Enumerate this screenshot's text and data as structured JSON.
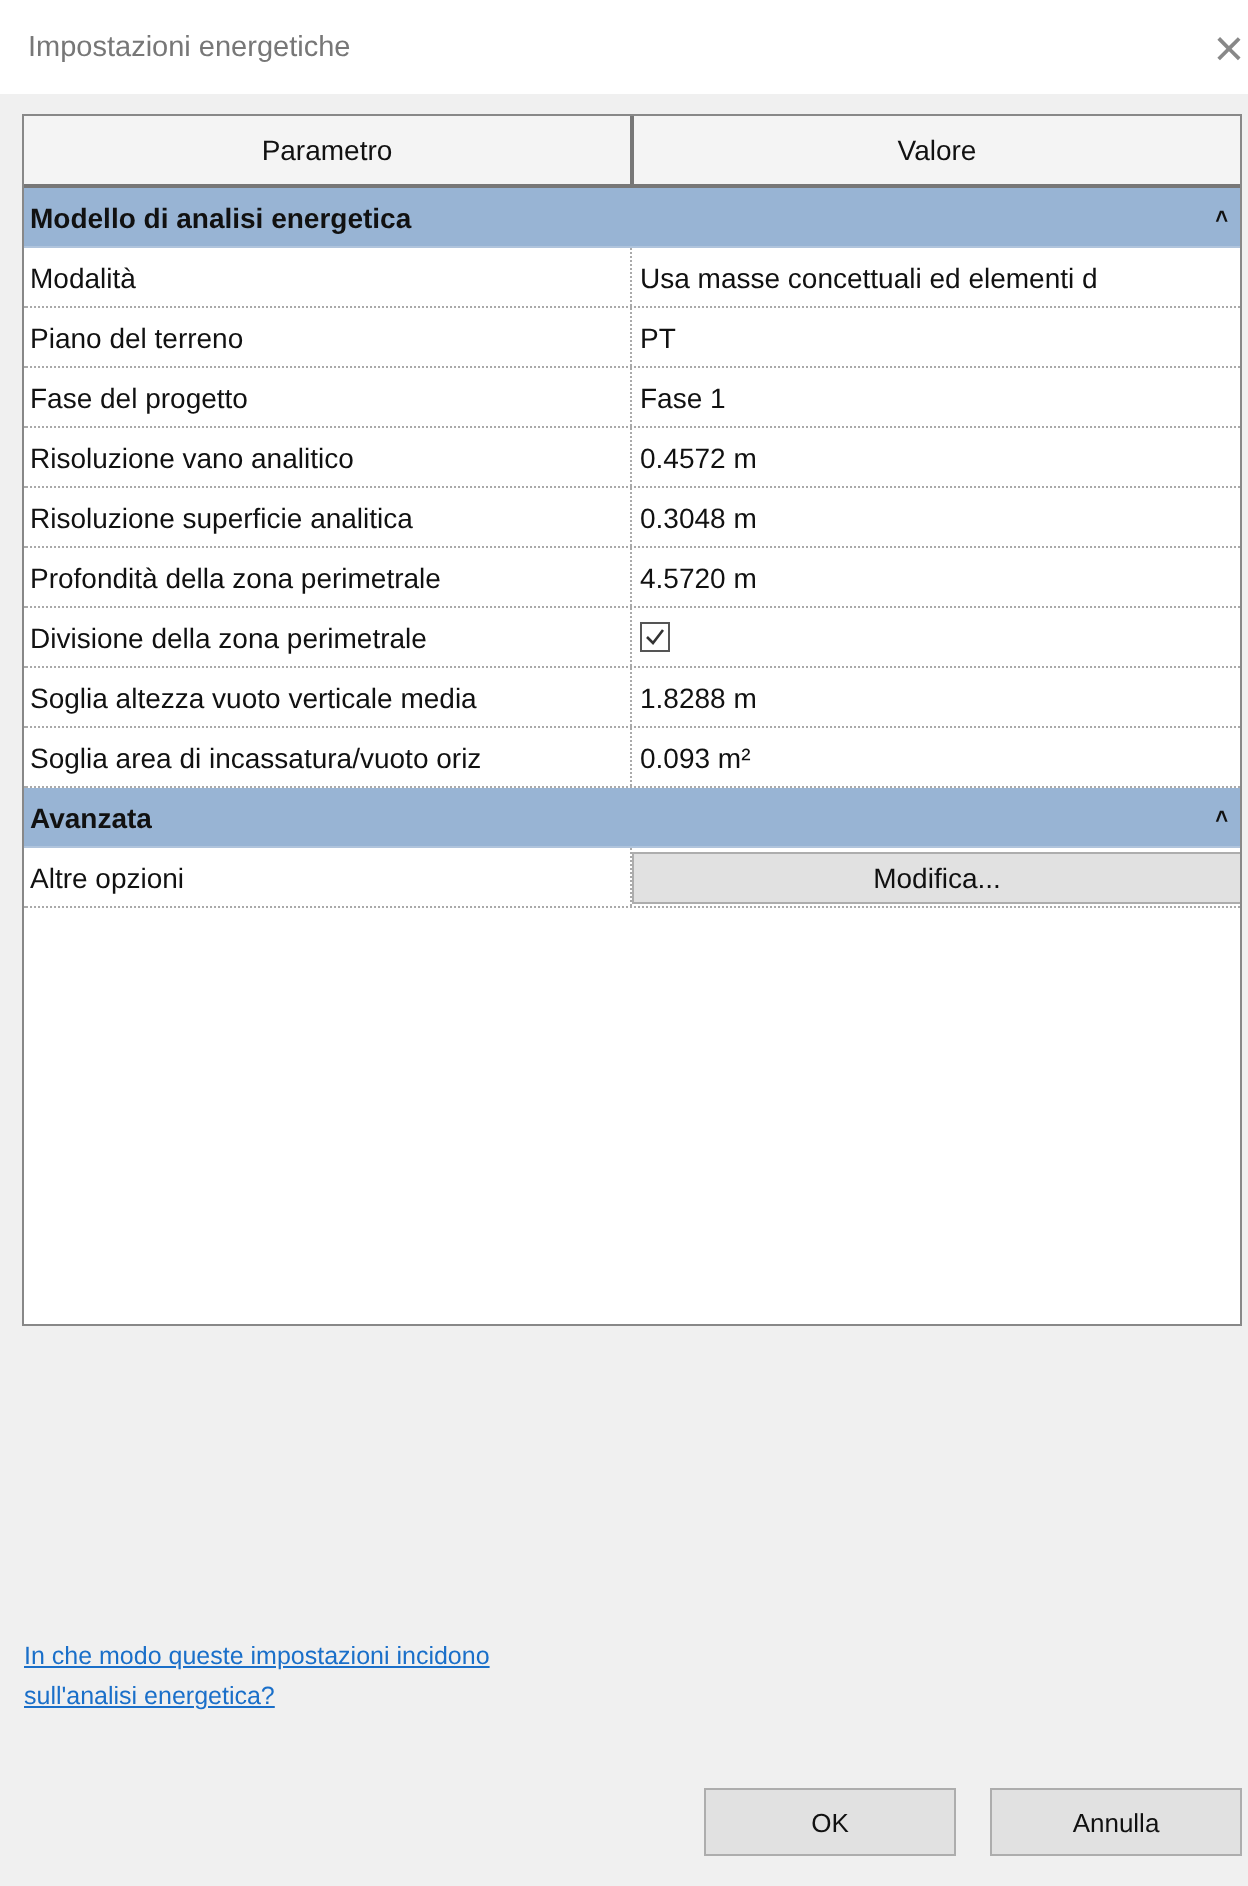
{
  "window": {
    "title": "Impostazioni energetiche",
    "close": "×"
  },
  "table": {
    "columns": [
      "Parametro",
      "Valore"
    ],
    "groups": [
      {
        "title": "Modello di analisi energetica",
        "toggle": "˄",
        "expanded": true,
        "rows": [
          {
            "name": "Modalità",
            "kind": "text",
            "value": "Usa masse concettuali ed elementi d"
          },
          {
            "name": "Piano del terreno",
            "kind": "text",
            "value": "PT"
          },
          {
            "name": "Fase del progetto",
            "kind": "text",
            "value": "Fase 1"
          },
          {
            "name": "Risoluzione vano analitico",
            "kind": "text",
            "value": "0.4572 m"
          },
          {
            "name": "Risoluzione superficie analitica",
            "kind": "text",
            "value": "0.3048 m"
          },
          {
            "name": "Profondità della zona perimetrale",
            "kind": "text",
            "value": "4.5720 m"
          },
          {
            "name": "Divisione della zona perimetrale",
            "kind": "checkbox",
            "checked": true
          },
          {
            "name": "Soglia altezza vuoto verticale media",
            "kind": "text",
            "value": "1.8288 m"
          },
          {
            "name": "Soglia area di incassatura/vuoto oriz",
            "kind": "text",
            "value": "0.093 m²"
          }
        ]
      },
      {
        "title": "Avanzata",
        "toggle": "˄",
        "expanded": true,
        "rows": [
          {
            "name": "Altre opzioni",
            "kind": "button",
            "value": "Modifica..."
          }
        ]
      }
    ]
  },
  "help_link": "In che modo queste impostazioni incidono sull'analisi energetica?",
  "buttons": [
    "OK",
    "Annulla"
  ]
}
